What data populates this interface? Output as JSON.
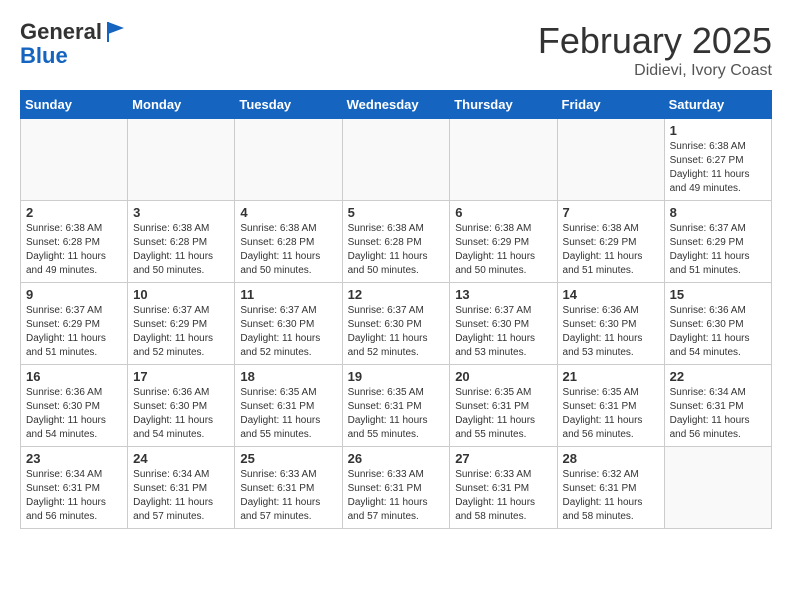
{
  "header": {
    "logo_line1": "General",
    "logo_line2": "Blue",
    "month": "February 2025",
    "location": "Didievi, Ivory Coast"
  },
  "weekdays": [
    "Sunday",
    "Monday",
    "Tuesday",
    "Wednesday",
    "Thursday",
    "Friday",
    "Saturday"
  ],
  "weeks": [
    [
      {
        "day": "",
        "info": ""
      },
      {
        "day": "",
        "info": ""
      },
      {
        "day": "",
        "info": ""
      },
      {
        "day": "",
        "info": ""
      },
      {
        "day": "",
        "info": ""
      },
      {
        "day": "",
        "info": ""
      },
      {
        "day": "1",
        "info": "Sunrise: 6:38 AM\nSunset: 6:27 PM\nDaylight: 11 hours and 49 minutes."
      }
    ],
    [
      {
        "day": "2",
        "info": "Sunrise: 6:38 AM\nSunset: 6:28 PM\nDaylight: 11 hours and 49 minutes."
      },
      {
        "day": "3",
        "info": "Sunrise: 6:38 AM\nSunset: 6:28 PM\nDaylight: 11 hours and 50 minutes."
      },
      {
        "day": "4",
        "info": "Sunrise: 6:38 AM\nSunset: 6:28 PM\nDaylight: 11 hours and 50 minutes."
      },
      {
        "day": "5",
        "info": "Sunrise: 6:38 AM\nSunset: 6:28 PM\nDaylight: 11 hours and 50 minutes."
      },
      {
        "day": "6",
        "info": "Sunrise: 6:38 AM\nSunset: 6:29 PM\nDaylight: 11 hours and 50 minutes."
      },
      {
        "day": "7",
        "info": "Sunrise: 6:38 AM\nSunset: 6:29 PM\nDaylight: 11 hours and 51 minutes."
      },
      {
        "day": "8",
        "info": "Sunrise: 6:37 AM\nSunset: 6:29 PM\nDaylight: 11 hours and 51 minutes."
      }
    ],
    [
      {
        "day": "9",
        "info": "Sunrise: 6:37 AM\nSunset: 6:29 PM\nDaylight: 11 hours and 51 minutes."
      },
      {
        "day": "10",
        "info": "Sunrise: 6:37 AM\nSunset: 6:29 PM\nDaylight: 11 hours and 52 minutes."
      },
      {
        "day": "11",
        "info": "Sunrise: 6:37 AM\nSunset: 6:30 PM\nDaylight: 11 hours and 52 minutes."
      },
      {
        "day": "12",
        "info": "Sunrise: 6:37 AM\nSunset: 6:30 PM\nDaylight: 11 hours and 52 minutes."
      },
      {
        "day": "13",
        "info": "Sunrise: 6:37 AM\nSunset: 6:30 PM\nDaylight: 11 hours and 53 minutes."
      },
      {
        "day": "14",
        "info": "Sunrise: 6:36 AM\nSunset: 6:30 PM\nDaylight: 11 hours and 53 minutes."
      },
      {
        "day": "15",
        "info": "Sunrise: 6:36 AM\nSunset: 6:30 PM\nDaylight: 11 hours and 54 minutes."
      }
    ],
    [
      {
        "day": "16",
        "info": "Sunrise: 6:36 AM\nSunset: 6:30 PM\nDaylight: 11 hours and 54 minutes."
      },
      {
        "day": "17",
        "info": "Sunrise: 6:36 AM\nSunset: 6:30 PM\nDaylight: 11 hours and 54 minutes."
      },
      {
        "day": "18",
        "info": "Sunrise: 6:35 AM\nSunset: 6:31 PM\nDaylight: 11 hours and 55 minutes."
      },
      {
        "day": "19",
        "info": "Sunrise: 6:35 AM\nSunset: 6:31 PM\nDaylight: 11 hours and 55 minutes."
      },
      {
        "day": "20",
        "info": "Sunrise: 6:35 AM\nSunset: 6:31 PM\nDaylight: 11 hours and 55 minutes."
      },
      {
        "day": "21",
        "info": "Sunrise: 6:35 AM\nSunset: 6:31 PM\nDaylight: 11 hours and 56 minutes."
      },
      {
        "day": "22",
        "info": "Sunrise: 6:34 AM\nSunset: 6:31 PM\nDaylight: 11 hours and 56 minutes."
      }
    ],
    [
      {
        "day": "23",
        "info": "Sunrise: 6:34 AM\nSunset: 6:31 PM\nDaylight: 11 hours and 56 minutes."
      },
      {
        "day": "24",
        "info": "Sunrise: 6:34 AM\nSunset: 6:31 PM\nDaylight: 11 hours and 57 minutes."
      },
      {
        "day": "25",
        "info": "Sunrise: 6:33 AM\nSunset: 6:31 PM\nDaylight: 11 hours and 57 minutes."
      },
      {
        "day": "26",
        "info": "Sunrise: 6:33 AM\nSunset: 6:31 PM\nDaylight: 11 hours and 57 minutes."
      },
      {
        "day": "27",
        "info": "Sunrise: 6:33 AM\nSunset: 6:31 PM\nDaylight: 11 hours and 58 minutes."
      },
      {
        "day": "28",
        "info": "Sunrise: 6:32 AM\nSunset: 6:31 PM\nDaylight: 11 hours and 58 minutes."
      },
      {
        "day": "",
        "info": ""
      }
    ]
  ]
}
